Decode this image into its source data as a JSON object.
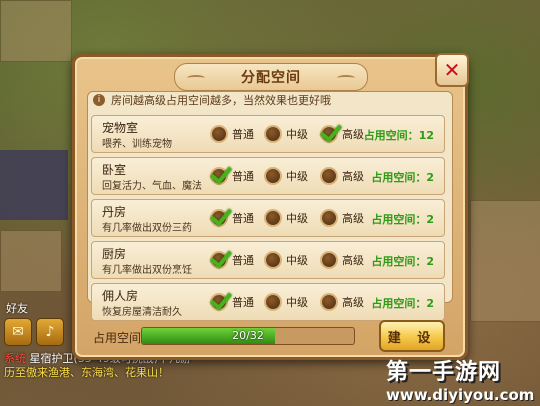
{
  "dialog": {
    "title": "分配空间",
    "tip": "房间越高级占用空间越多，当然效果也更好哦",
    "close_icon": "close-x-icon",
    "options": [
      "普通",
      "中级",
      "高级"
    ],
    "space_prefix": "占用空间：",
    "rooms": [
      {
        "name": "宠物室",
        "desc": "喂养、训练宠物",
        "selected_level": "高级",
        "space": "12"
      },
      {
        "name": "卧室",
        "desc": "回复活力、气血、魔法",
        "selected_level": "普通",
        "space": "2"
      },
      {
        "name": "丹房",
        "desc": "有几率做出双份三药",
        "selected_level": "普通",
        "space": "2"
      },
      {
        "name": "厨房",
        "desc": "有几率做出双份烹饪",
        "selected_level": "普通",
        "space": "2"
      },
      {
        "name": "佣人房",
        "desc": "恢复房屋清洁耐久",
        "selected_level": "普通",
        "space": "2"
      }
    ],
    "footer": {
      "label": "占用空间",
      "progress_text": "20/32",
      "progress_fraction": 0.625,
      "build_label": "建 设"
    }
  },
  "background": {
    "friend_label": "好友",
    "chat_tag": "系统",
    "chat_line1": "星宿护卫(35-49级可挑战)下凡游",
    "chat_line2": "历至傲来渔港、东海湾、花果山！"
  },
  "watermark": {
    "text": "第一手游网",
    "url": "www.diyiyou.com"
  },
  "colors": {
    "check_green": "#49b21a",
    "space_green": "#2f9a18",
    "close_red": "#c3121b"
  }
}
